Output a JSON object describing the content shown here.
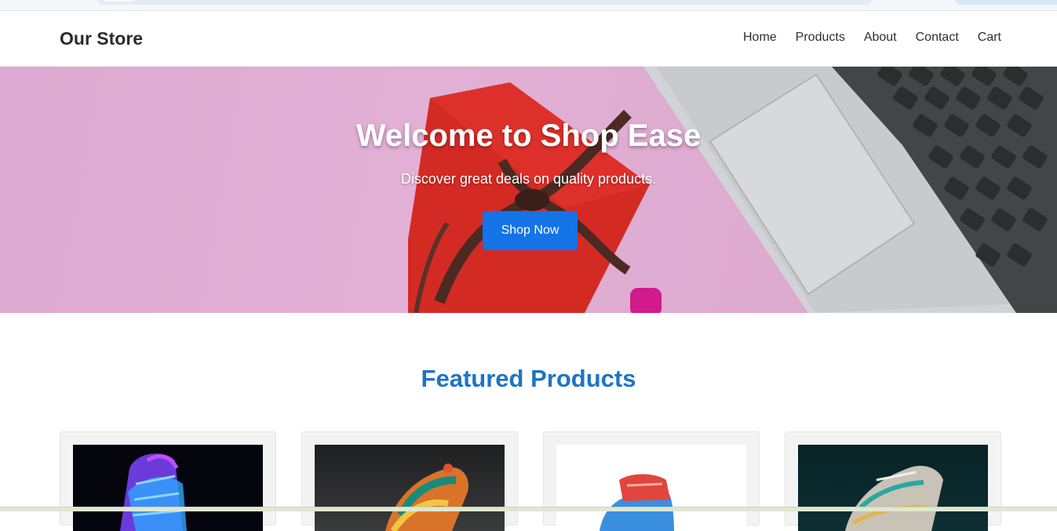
{
  "header": {
    "brand": "Our Store",
    "nav": [
      {
        "label": "Home"
      },
      {
        "label": "Products"
      },
      {
        "label": "About"
      },
      {
        "label": "Contact"
      },
      {
        "label": "Cart"
      }
    ]
  },
  "hero": {
    "title": "Welcome to Shop Ease",
    "subtitle": "Discover great deals on quality products.",
    "cta_label": "Shop Now"
  },
  "featured": {
    "title": "Featured Products",
    "products": [
      {
        "image": "neon-sneaker-image"
      },
      {
        "image": "colorful-sneaker-image"
      },
      {
        "image": "red-blue-sneaker-image"
      },
      {
        "image": "metallic-sneaker-image"
      }
    ]
  },
  "colors": {
    "accent": "#1473e6",
    "section_title": "#1d74c7",
    "hero_bg": "#dfacd2"
  }
}
